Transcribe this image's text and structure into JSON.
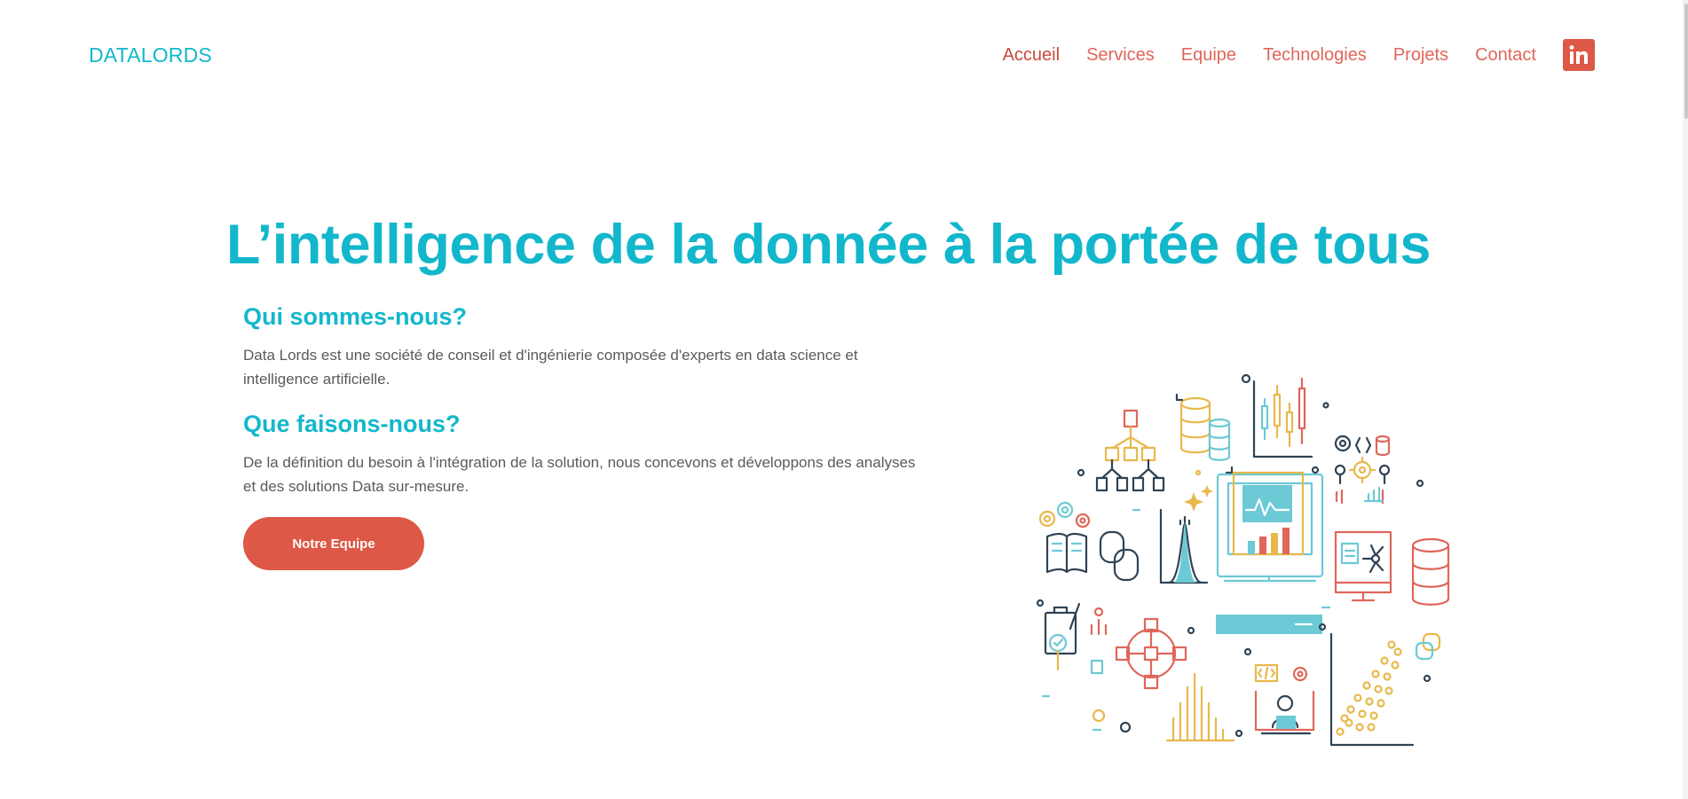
{
  "header": {
    "brand": "DATALORDS",
    "nav": [
      {
        "label": "Accueil",
        "active": true
      },
      {
        "label": "Services",
        "active": false
      },
      {
        "label": "Equipe",
        "active": false
      },
      {
        "label": "Technologies",
        "active": false
      },
      {
        "label": "Projets",
        "active": false
      },
      {
        "label": "Contact",
        "active": false
      }
    ],
    "linkedin_icon": "linkedin-icon"
  },
  "hero": {
    "title": "L’intelligence de la donnée à la portée de tous",
    "sections": [
      {
        "heading": "Qui sommes-nous?",
        "text": "Data Lords est une société de conseil et d'ingénierie composée d'experts en data science et intelligence artificielle."
      },
      {
        "heading": "Que faisons-nous?",
        "text": "De la définition du besoin à l'intégration de la solution, nous concevons et développons des analyses et des solutions Data sur-mesure."
      }
    ],
    "cta_label": "Notre Equipe",
    "illustration": "data-science-illustration"
  },
  "colors": {
    "primary": "#13b7cc",
    "accent": "#dd5846",
    "text": "#5a5a5a"
  }
}
